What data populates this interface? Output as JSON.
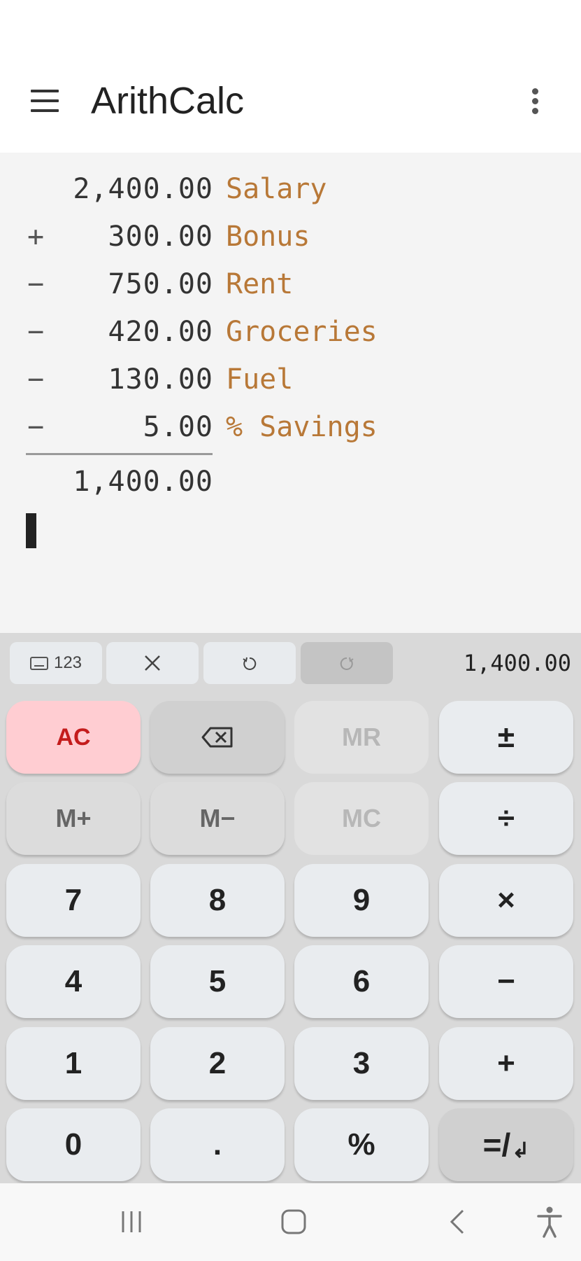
{
  "app": {
    "title": "ArithCalc"
  },
  "tape": {
    "lines": [
      {
        "op": "",
        "value": "2,400.00",
        "note": "Salary"
      },
      {
        "op": "+",
        "value": "300.00",
        "note": "Bonus"
      },
      {
        "op": "−",
        "value": "750.00",
        "note": "Rent"
      },
      {
        "op": "−",
        "value": "420.00",
        "note": "Groceries"
      },
      {
        "op": "−",
        "value": "130.00",
        "note": "Fuel"
      },
      {
        "op": "−",
        "value": "5.00",
        "note": "% Savings"
      }
    ],
    "total": "1,400.00"
  },
  "toolbar": {
    "keyboard_label": "123",
    "result": "1,400.00"
  },
  "keys": {
    "ac": "AC",
    "mr": "MR",
    "plusminus": "±",
    "mplus": "M+",
    "mminus": "M−",
    "mc": "MC",
    "divide": "÷",
    "seven": "7",
    "eight": "8",
    "nine": "9",
    "multiply": "×",
    "four": "4",
    "five": "5",
    "six": "6",
    "minus": "−",
    "one": "1",
    "two": "2",
    "three": "3",
    "plus": "+",
    "zero": "0",
    "dot": ".",
    "percent": "%",
    "equals": "=/",
    "enter_glyph": "↲"
  },
  "icons": {
    "menu": "menu-icon",
    "more": "more-vert-icon",
    "clear_line": "close-icon",
    "undo": "undo-icon",
    "redo": "redo-icon",
    "backspace": "backspace-icon",
    "nav_recents": "recents-icon",
    "nav_home": "home-icon",
    "nav_back": "back-icon",
    "accessibility": "accessibility-icon"
  },
  "colors": {
    "note": "#b87837",
    "ac_bg": "#ffcdd2",
    "ac_text": "#c41c1c"
  }
}
